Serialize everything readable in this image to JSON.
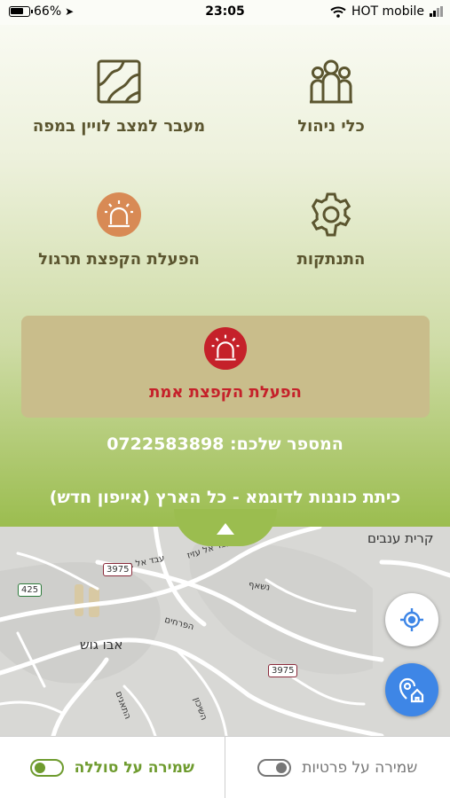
{
  "status_bar": {
    "battery": "66%",
    "time": "23:05",
    "carrier": "HOT mobile"
  },
  "tiles": {
    "management_tools": "כלי ניהול",
    "map_mode": "מעבר למצב לויין במפה",
    "logout": "התנתקות",
    "drill_alert": "הפעלת הקפצת תרגול"
  },
  "real_alert": "הפעלת הקפצת אמת",
  "phone_label": "המספר שלכם: 0722583898",
  "site_name": "כיתת כוננות לדוגמא - כל הארץ (אייפון חדש)",
  "map": {
    "labels": {
      "kiryat_anavim": "קרית ענבים",
      "abu_gosh": "אבו גוש",
      "street_1": "עבד אל עזיז",
      "street_2": "עבד אל ג׳בר",
      "street_3": "נשאף",
      "street_4": "הפרחים",
      "street_5": "השיכון",
      "street_6": "התאנים"
    },
    "road_numbers": [
      "3975",
      "425",
      "3975"
    ]
  },
  "bottom": {
    "threshold_guard": "שמירה על סוללה",
    "privacy_guard": "שמירה על פרטיות",
    "threshold_on": true,
    "privacy_on": false
  },
  "colors": {
    "accent_green": "#6e9b2e",
    "alert_red": "#c5212a",
    "drill_orange": "#d88a55",
    "fab_blue": "#3e86e6"
  }
}
